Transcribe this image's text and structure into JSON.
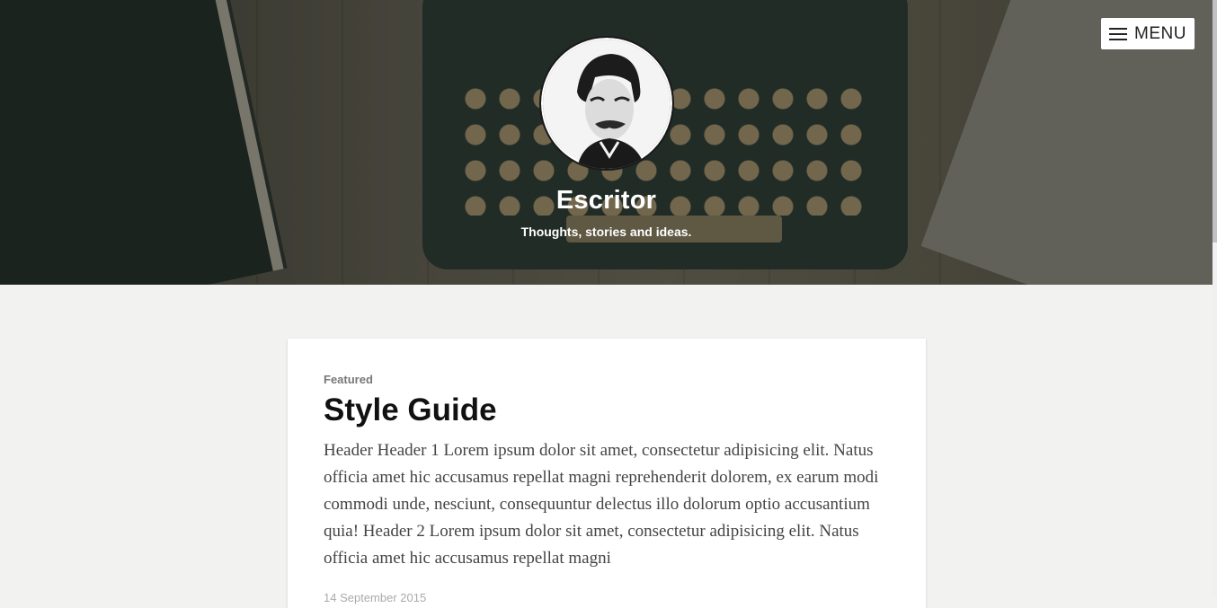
{
  "site": {
    "title": "Escritor",
    "tagline": "Thoughts, stories and ideas."
  },
  "menu": {
    "label": "MENU",
    "icon": "hamburger-icon"
  },
  "featured_post": {
    "tag": "Featured",
    "title": "Style Guide",
    "excerpt": "Header Header 1 Lorem ipsum dolor sit amet, consectetur adipisicing elit. Natus officia amet hic accusamus repellat magni reprehenderit dolorem, ex earum modi commodi unde, nesciunt, consequuntur delectus illo dolorum optio accusantium quia! Header 2 Lorem ipsum dolor sit amet, consectetur adipisicing elit. Natus officia amet hic accusamus repellat magni",
    "date": "14 September 2015"
  },
  "colors": {
    "page_background": "#f2f2f1",
    "card_background": "#ffffff",
    "title_text": "#111111",
    "header_text": "#ffffff"
  }
}
